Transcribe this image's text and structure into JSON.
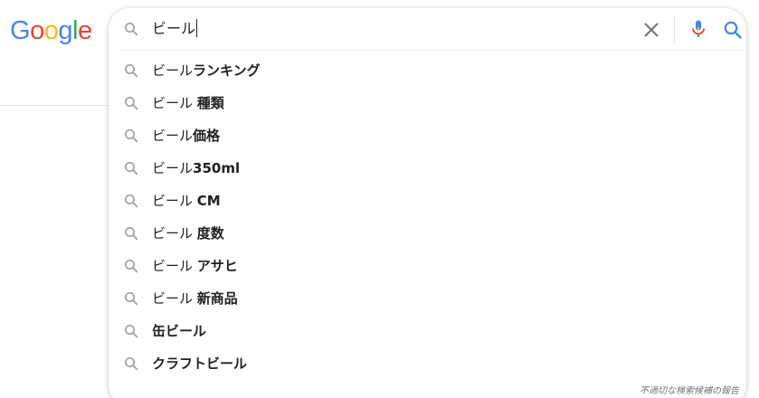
{
  "logo": {
    "text": [
      "G",
      "o",
      "o",
      "g",
      "l",
      "e"
    ],
    "colors": [
      "#4285F4",
      "#EA4335",
      "#FBBC05",
      "#4285F4",
      "#34A853",
      "#EA4335"
    ]
  },
  "search": {
    "query": "ビール",
    "icons": {
      "lead": "search-icon",
      "clear": "close-icon",
      "voice": "microphone-icon",
      "submit": "search-icon"
    }
  },
  "suggestions": [
    {
      "prefix": "ビール",
      "suffix": "ランキング"
    },
    {
      "prefix": "ビール ",
      "suffix": "種類"
    },
    {
      "prefix": "ビール",
      "suffix": "価格"
    },
    {
      "prefix": "ビール",
      "suffix": "350ml"
    },
    {
      "prefix": "ビール ",
      "suffix": "CM"
    },
    {
      "prefix": "ビール ",
      "suffix": "度数"
    },
    {
      "prefix": "ビール ",
      "suffix": "アサヒ"
    },
    {
      "prefix": "ビール ",
      "suffix": "新商品"
    },
    {
      "prefix": "",
      "suffix": "缶ビール"
    },
    {
      "prefix": "",
      "suffix": "クラフトビール"
    }
  ],
  "report_link": "不適切な検索候補の報告",
  "colors": {
    "icon_gray": "#9aa0a6",
    "text": "#202124",
    "accent_blue": "#4285F4"
  }
}
